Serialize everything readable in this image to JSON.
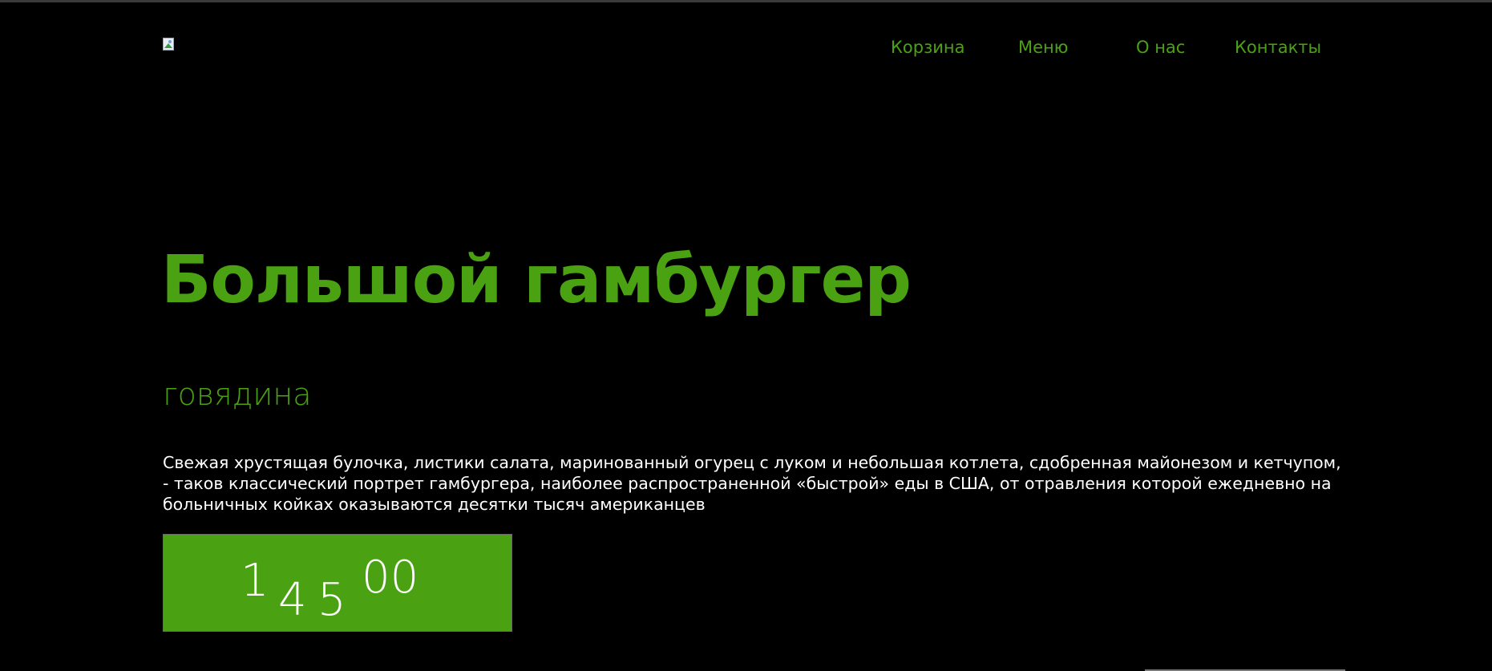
{
  "nav": {
    "items": [
      {
        "label": "Корзина"
      },
      {
        "label": "Меню"
      },
      {
        "label": "О нас"
      },
      {
        "label": "Контакты"
      }
    ]
  },
  "product": {
    "title": "Большой гамбургер",
    "subtitle": "говядина",
    "description": "Свежая хрустящая булочка, листики салата, маринованный огурец с луком и небольшая котлета, сдобренная майонезом и кетчупом, - таков классический портрет гамбургера, наиболее распространенной «быстрой» еды в США, от отравления которой ежедневно на больничных койках оказываются десятки тысяч американцев",
    "price": {
      "digit_1": "1",
      "digit_2": "4",
      "digit_3": "5",
      "cents": "00"
    }
  },
  "colors": {
    "accent": "#4aa212",
    "background": "#000000",
    "text": "#ffffff"
  },
  "icons": {
    "logo": "broken-image-icon"
  }
}
